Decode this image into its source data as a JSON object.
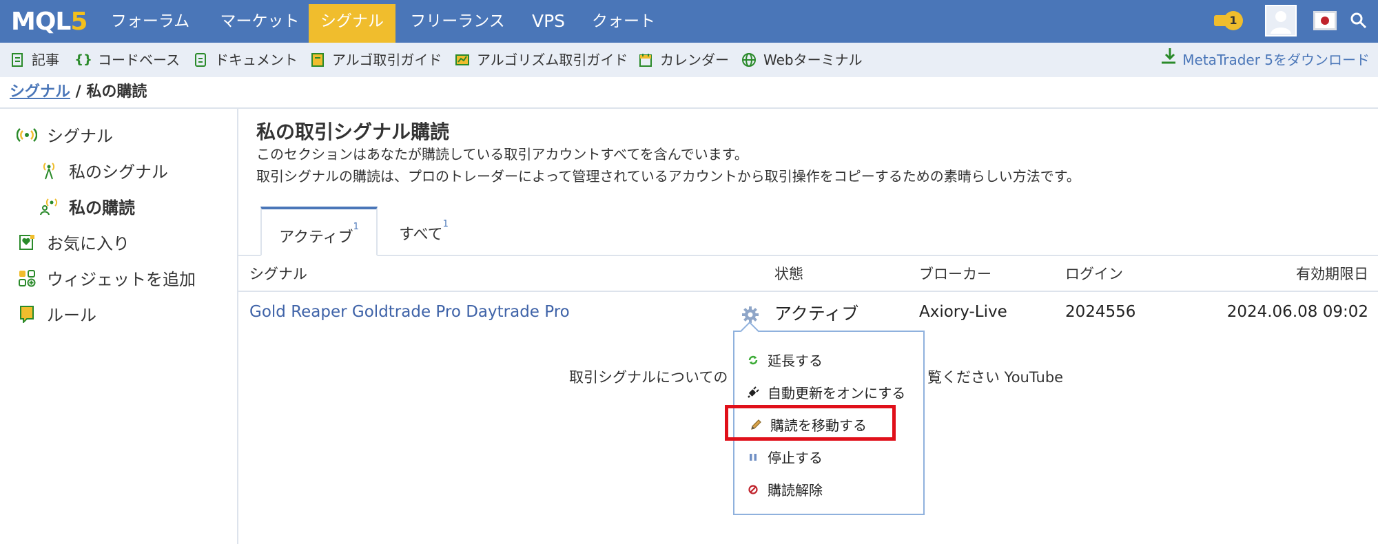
{
  "logo": {
    "text_main": "MQL",
    "text_five": "5"
  },
  "topnav": {
    "items": [
      {
        "label": "フォーラム"
      },
      {
        "label": "マーケット"
      },
      {
        "label": "シグナル"
      },
      {
        "label": "フリーランス"
      },
      {
        "label": "VPS"
      },
      {
        "label": "クォート"
      }
    ],
    "active_index": 2,
    "notification_count": "1"
  },
  "subnav": {
    "items": [
      {
        "label": "記事",
        "icon": "article-icon"
      },
      {
        "label": "コードベース",
        "icon": "braces-icon"
      },
      {
        "label": "ドキュメント",
        "icon": "document-icon"
      },
      {
        "label": "アルゴ取引ガイド",
        "icon": "book-icon"
      },
      {
        "label": "アルゴリズム取引ガイド",
        "icon": "guide-icon"
      },
      {
        "label": "カレンダー",
        "icon": "calendar-icon"
      },
      {
        "label": "Webターミナル",
        "icon": "globe-icon"
      }
    ],
    "download_label": "MetaTrader 5をダウンロード"
  },
  "breadcrumb": {
    "link": "シグナル",
    "separator": " / ",
    "current": "私の購読"
  },
  "sidebar": {
    "items": [
      {
        "label": "シグナル"
      },
      {
        "label": "私のシグナル"
      },
      {
        "label": "私の購読"
      },
      {
        "label": "お気に入り"
      },
      {
        "label": "ウィジェットを追加"
      },
      {
        "label": "ルール"
      }
    ]
  },
  "main": {
    "title": "私の取引シグナル購読",
    "desc1": "このセクションはあなたが購読している取引アカウントすべてを含んでいます。",
    "desc2": "取引シグナルの購読は、プロのトレーダーによって管理されているアカウントから取引操作をコピーするための素晴らしい方法です。",
    "tabs": [
      {
        "label": "アクティブ",
        "count": "1"
      },
      {
        "label": "すべて",
        "count": "1"
      }
    ],
    "table": {
      "headers": {
        "signal": "シグナル",
        "status": "状態",
        "broker": "ブローカー",
        "login": "ログイン",
        "expiry": "有効期限日"
      },
      "row": {
        "signal": "Gold Reaper Goldtrade Pro Daytrade Pro",
        "status": "アクティブ",
        "broker": "Axiory-Live",
        "login": "2024556",
        "expiry": "2024.06.08 09:02"
      }
    },
    "info_left": "取引シグナルについての",
    "info_right": "覧ください YouTube"
  },
  "menu": {
    "items": [
      {
        "label": "延長する",
        "icon": "renew-icon"
      },
      {
        "label": "自動更新をオンにする",
        "icon": "plug-icon"
      },
      {
        "label": "購読を移動する",
        "icon": "pencil-icon"
      },
      {
        "label": "停止する",
        "icon": "pause-icon"
      },
      {
        "label": "購読解除",
        "icon": "cancel-icon"
      }
    ]
  },
  "colors": {
    "nav_blue": "#4a76b8",
    "active_yellow": "#f0bd2d",
    "highlight_red": "#e0101a",
    "link_blue": "#3f63a8"
  }
}
